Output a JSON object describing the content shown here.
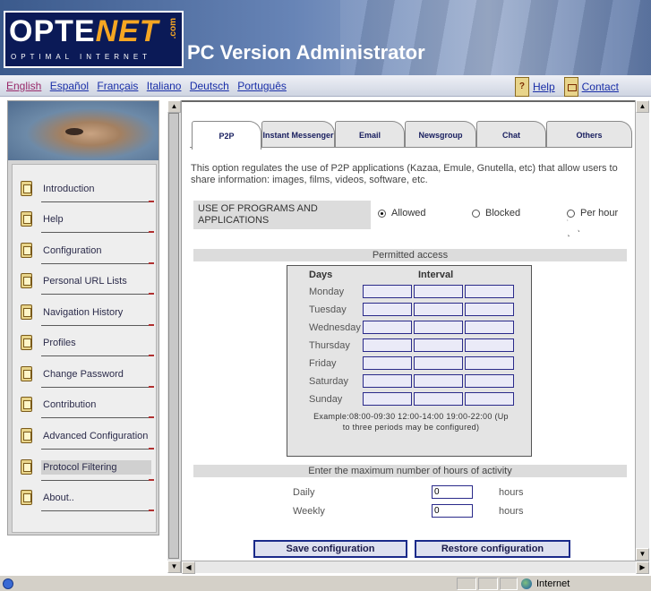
{
  "header": {
    "logo_main_left": "OPTE",
    "logo_main_right": "NET",
    "logo_com": ".com",
    "logo_tagline": "OPTIMAL INTERNET",
    "app_title": "PC Version Administrator"
  },
  "languages": [
    "English",
    "Español",
    "Français",
    "Italiano",
    "Deutsch",
    "Português"
  ],
  "active_language": "English",
  "top_links": {
    "help": "Help",
    "contact": "Contact"
  },
  "sidebar": {
    "items": [
      {
        "label": "Introduction"
      },
      {
        "label": "Help"
      },
      {
        "label": "Configuration"
      },
      {
        "label": "Personal URL Lists"
      },
      {
        "label": "Navigation History"
      },
      {
        "label": "Profiles"
      },
      {
        "label": "Change Password"
      },
      {
        "label": "Contribution"
      },
      {
        "label": "Advanced Configuration"
      },
      {
        "label": "Protocol Filtering",
        "selected": true
      },
      {
        "label": "About.."
      }
    ]
  },
  "tabs": [
    {
      "label": "P2P",
      "active": true
    },
    {
      "label": "Instant Messenger"
    },
    {
      "label": "Email"
    },
    {
      "label": "Newsgroup"
    },
    {
      "label": "Chat"
    },
    {
      "label": "Others"
    }
  ],
  "intro_text": "This option regulates the use of P2P applications (Kazaa, Emule, Gnutella, etc) that allow users to share information: images, films, videos, software, etc.",
  "usage": {
    "label": "USE OF PROGRAMS AND APPLICATIONS",
    "options": [
      "Allowed",
      "Blocked",
      "Per hour"
    ],
    "selected": "Allowed"
  },
  "permitted_access": {
    "title": "Permitted access",
    "col_days": "Days",
    "col_interval": "Interval",
    "days": [
      "Monday",
      "Tuesday",
      "Wednesday",
      "Thursday",
      "Friday",
      "Saturday",
      "Sunday"
    ],
    "example": "Example:08:00-09:30 12:00-14:00 19:00-22:00 (Up to three periods may be configured)"
  },
  "hours_activity": {
    "title": "Enter the maximum number of hours of activity",
    "daily_label": "Daily",
    "daily_value": "0",
    "weekly_label": "Weekly",
    "weekly_value": "0",
    "unit": "hours"
  },
  "buttons": {
    "save": "Save configuration",
    "restore": "Restore configuration"
  },
  "status_bar": {
    "zone": "Internet"
  },
  "colors": {
    "header_blue": "#3b5a8c",
    "logo_navy": "#0b1a57",
    "logo_orange": "#f5a623",
    "link_blue": "#1a2fa8",
    "button_border": "#1a2a8a"
  }
}
